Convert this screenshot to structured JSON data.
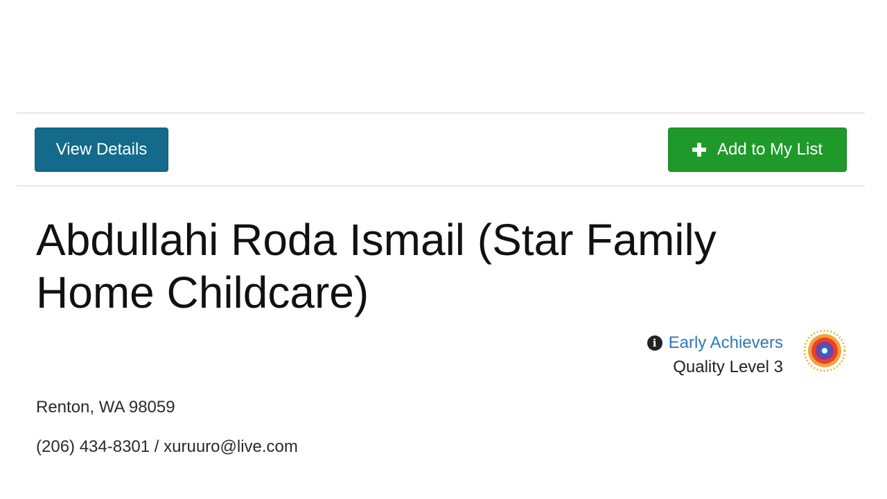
{
  "actions": {
    "view_details_label": "View Details",
    "add_to_list_label": "Add to My List"
  },
  "provider": {
    "name": "Abdullahi Roda Ismail (Star Family Home Childcare)",
    "address": "Renton, WA 98059",
    "phone": "(206) 434-8301",
    "separator": " / ",
    "email": "xuruuro@live.com"
  },
  "rating": {
    "program_name": "Early Achievers",
    "quality_level": "Quality Level 3",
    "info_icon_glyph": "i"
  },
  "colors": {
    "view_details_button": "#136a8a",
    "add_button": "#1f9a2a",
    "link": "#2f78b8"
  },
  "icons": {
    "add": "plus-icon",
    "info": "info-circle-icon",
    "rating_badge": "early-achievers-badge-icon"
  }
}
